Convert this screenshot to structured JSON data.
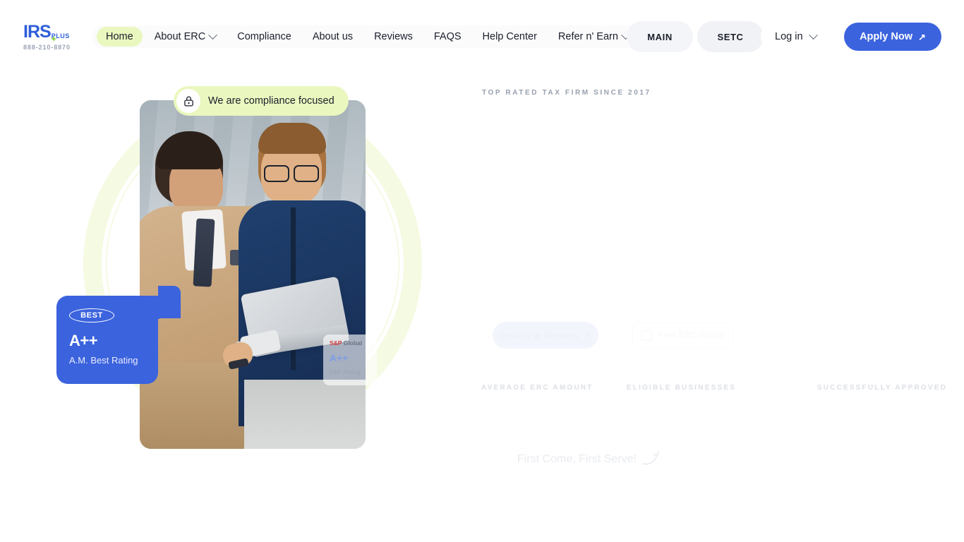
{
  "brand": {
    "name": "IRS",
    "suffix": "PLUS",
    "phone": "888-210-8870"
  },
  "nav": {
    "items": [
      {
        "label": "Home",
        "active": true,
        "has_dropdown": false
      },
      {
        "label": "About ERC",
        "active": false,
        "has_dropdown": true
      },
      {
        "label": "Compliance",
        "active": false,
        "has_dropdown": false
      },
      {
        "label": "About us",
        "active": false,
        "has_dropdown": false
      },
      {
        "label": "Reviews",
        "active": false,
        "has_dropdown": false
      },
      {
        "label": "FAQS",
        "active": false,
        "has_dropdown": false
      },
      {
        "label": "Help Center",
        "active": false,
        "has_dropdown": false
      },
      {
        "label": "Refer n' Earn",
        "active": false,
        "has_dropdown": true
      }
    ],
    "segment_main": "MAIN",
    "segment_setc": "SETC",
    "login_label": "Log in",
    "apply_label": "Apply Now",
    "apply_arrow": "↗"
  },
  "hero": {
    "badge": {
      "icon": "lock-icon",
      "text": "We are compliance focused"
    },
    "am_best": {
      "logo_text": "BEST",
      "grade": "A++",
      "label": "A.M. Best Rating"
    },
    "sp_global": {
      "brand_amp": "S&P",
      "brand_global": "Global",
      "grade": "A++",
      "label": "S&P Rating"
    }
  },
  "content": {
    "eyebrow": "TOP RATED TAX FIRM SINCE 2017",
    "cta_primary": "Qualify in Minutes",
    "cta_primary_arrow": "↗",
    "cta_secondary": "Free ERC Guide",
    "stats": [
      {
        "label": "AVERAGE ERC AMOUNT"
      },
      {
        "label": "ELIGIBLE BUSINESSES"
      },
      {
        "label": "SUCCESSFULLY APPROVED"
      }
    ],
    "footer_note": "First Come, First Serve!"
  },
  "colors": {
    "accent_blue": "#3b63de",
    "accent_lime": "#eaf7bf",
    "text_dark": "#1b1f2a"
  }
}
